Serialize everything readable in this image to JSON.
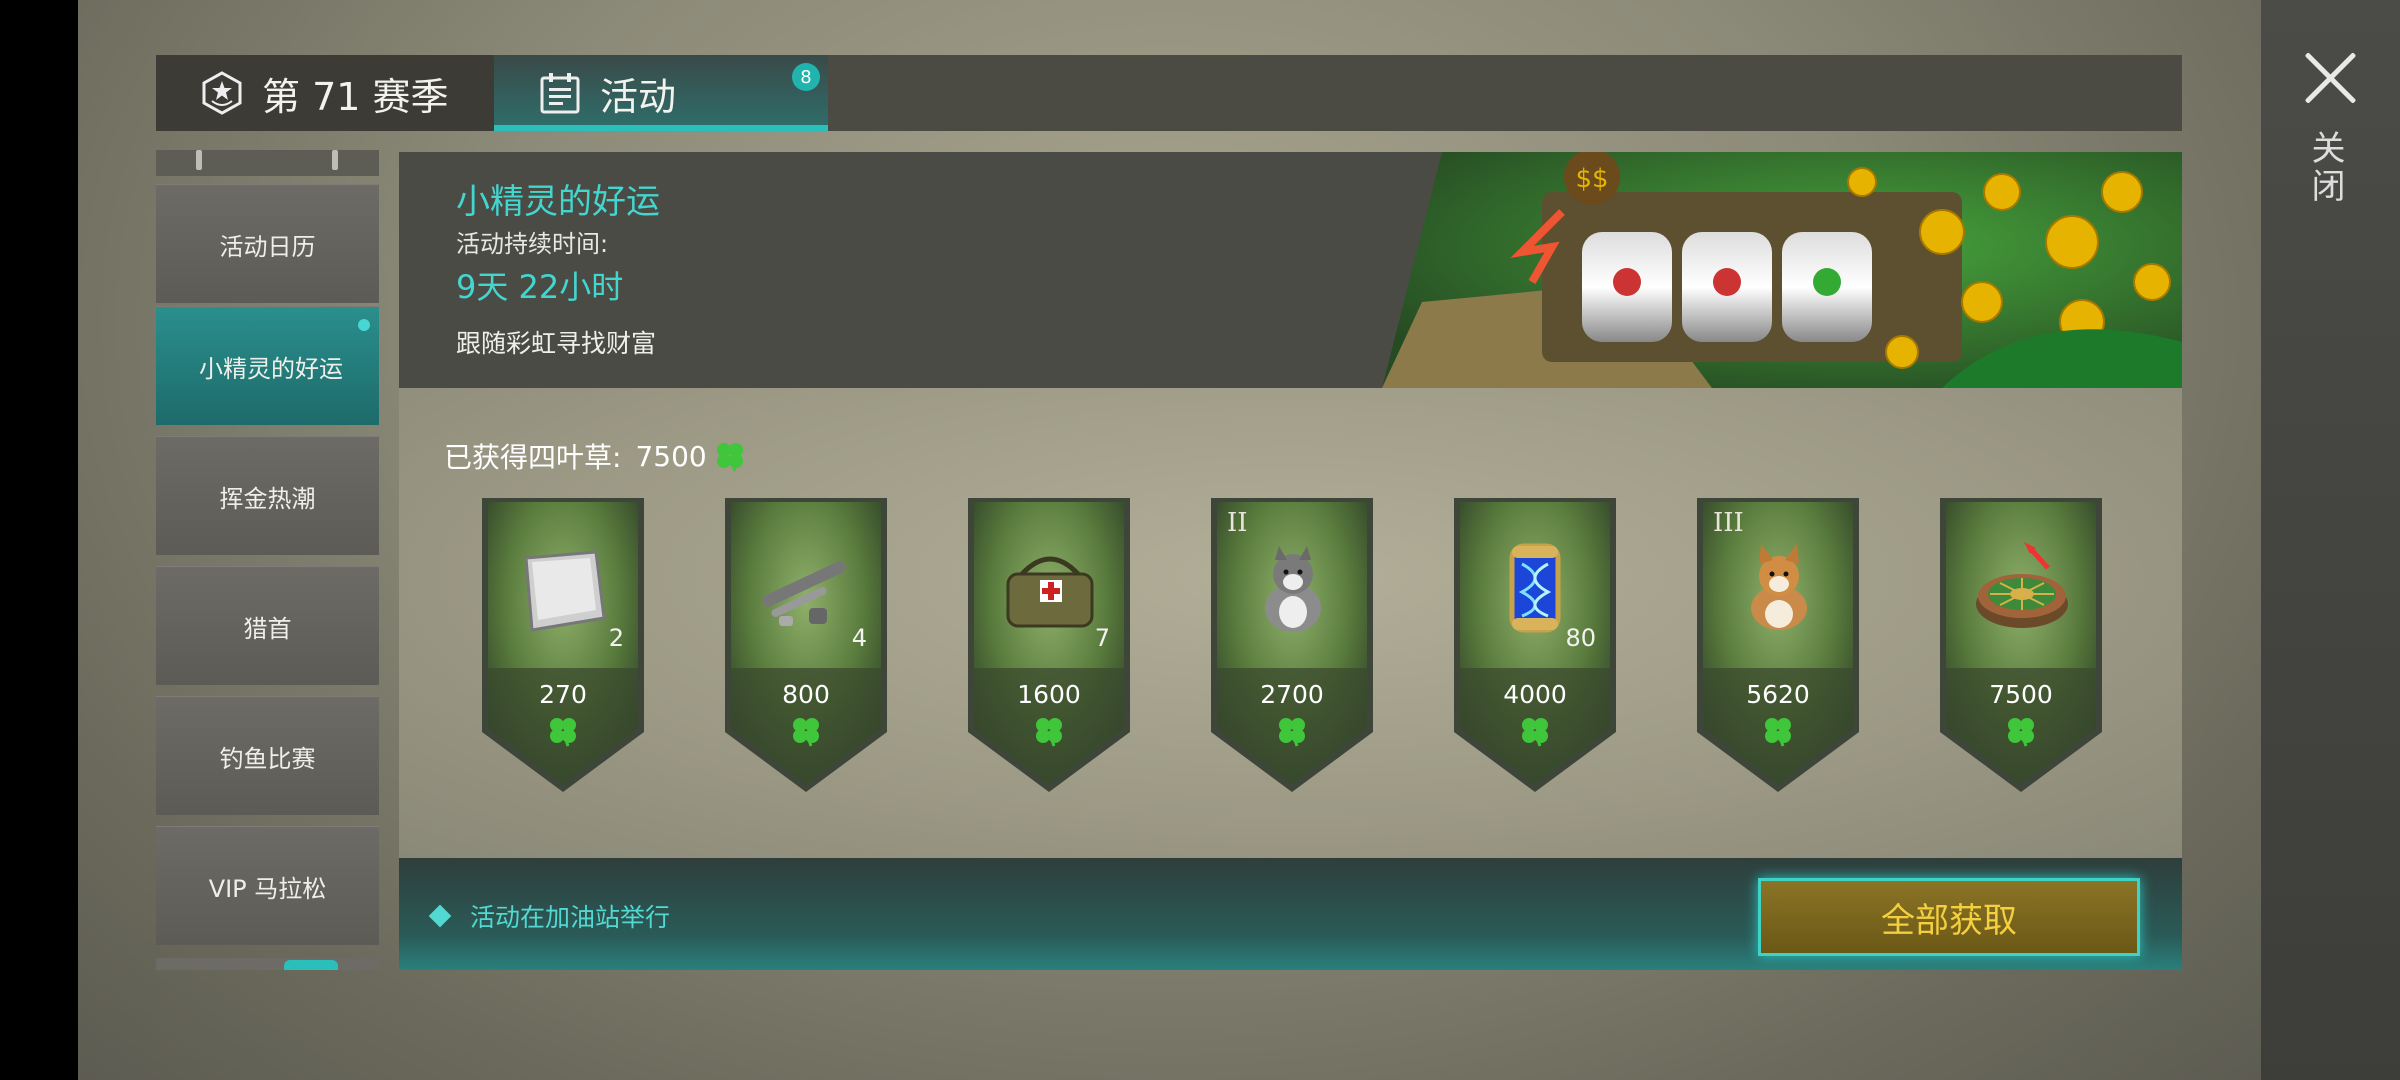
{
  "window": {
    "close_label": "关闭"
  },
  "tabs": [
    {
      "label": "第 71 赛季"
    },
    {
      "label": "活动",
      "badge": "8"
    }
  ],
  "sidebar": {
    "items": [
      {
        "label": "活动日历"
      },
      {
        "label": "小精灵的好运",
        "active": true
      },
      {
        "label": "挥金热潮"
      },
      {
        "label": "猎首"
      },
      {
        "label": "钓鱼比赛"
      },
      {
        "label": "VIP 马拉松"
      }
    ]
  },
  "event": {
    "title": "小精灵的好运",
    "duration_label": "活动持续时间:",
    "duration_value": "9天 22小时",
    "description": "跟随彩虹寻找财富"
  },
  "rewards": {
    "earned_label": "已获得四叶草:",
    "earned_value": "7500",
    "items": [
      {
        "icon": "metal-plate-icon",
        "quantity": "2",
        "cost": "270"
      },
      {
        "icon": "weapon-parts-icon",
        "quantity": "4",
        "cost": "800"
      },
      {
        "icon": "medical-bag-icon",
        "quantity": "7",
        "cost": "1600"
      },
      {
        "icon": "husky-dog-icon",
        "tier": "II",
        "cost": "2700"
      },
      {
        "icon": "dna-capsule-icon",
        "quantity": "80",
        "cost": "4000"
      },
      {
        "icon": "corgi-dog-icon",
        "tier": "III",
        "cost": "5620"
      },
      {
        "icon": "roulette-wheel-icon",
        "cost": "7500"
      }
    ]
  },
  "footer": {
    "note": "活动在加油站举行",
    "claim_all": "全部获取"
  },
  "colors": {
    "accent_teal": "#43d6cf",
    "clover_green": "#3fc63b",
    "button_gold": "#f4cf3f"
  }
}
